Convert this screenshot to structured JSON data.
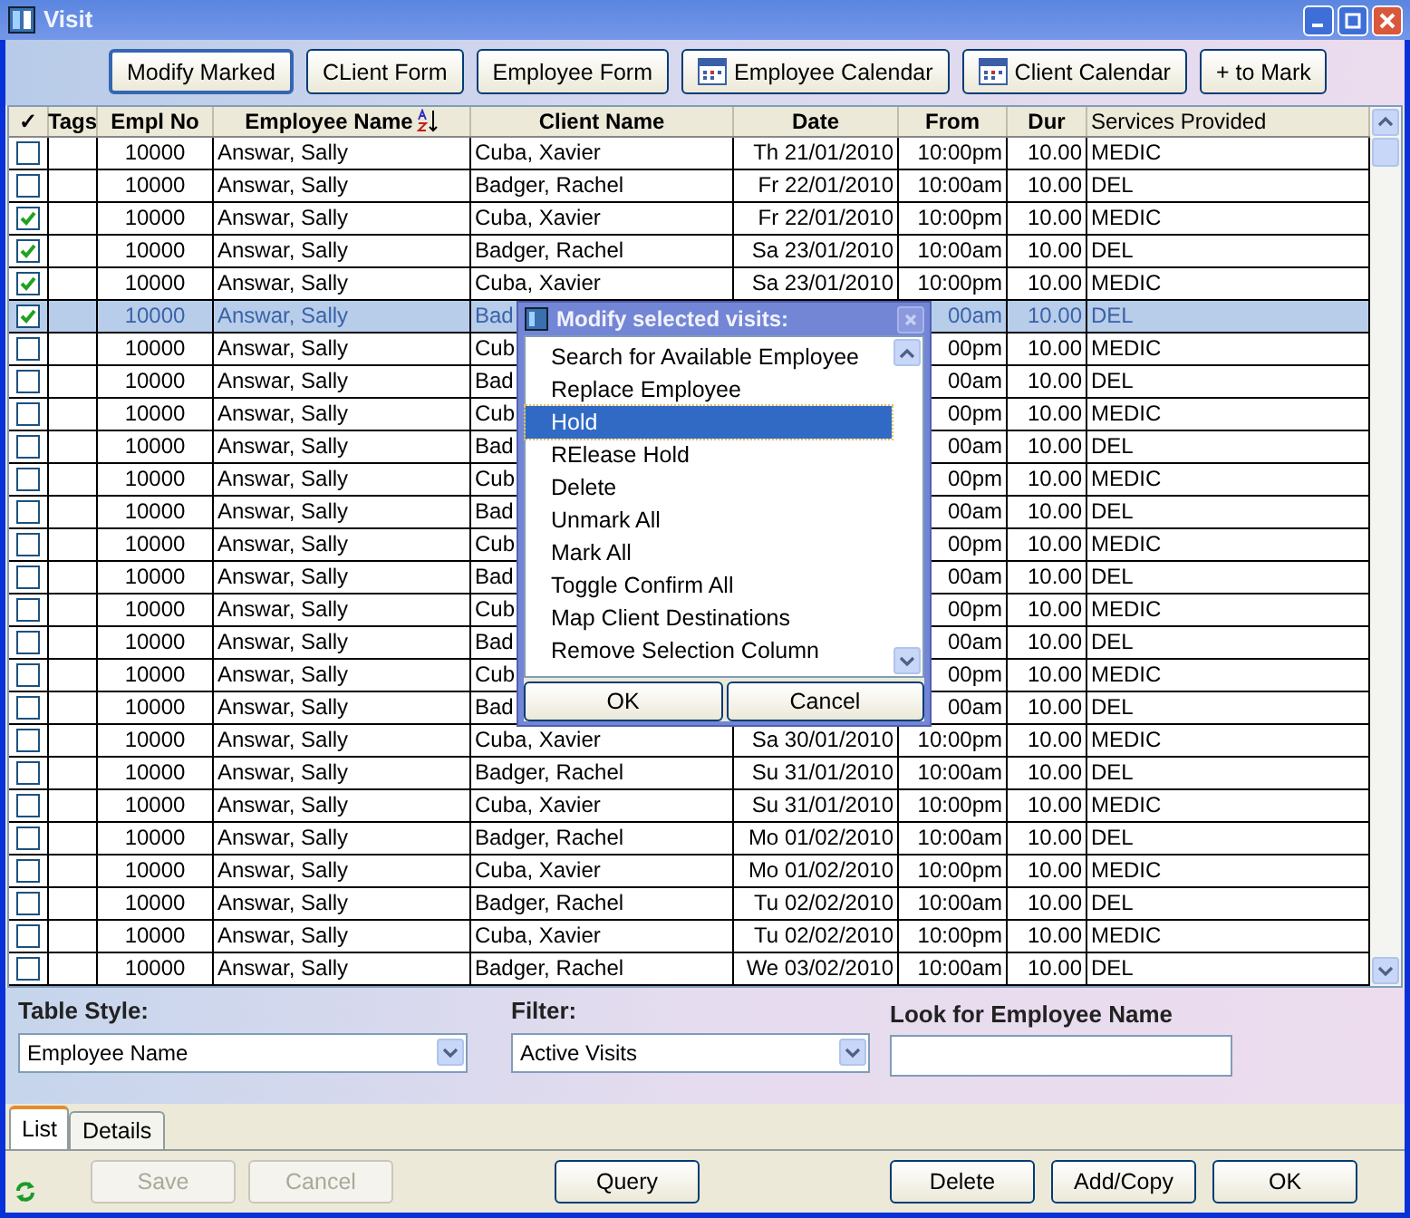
{
  "window": {
    "title": "Visit"
  },
  "toolbar": {
    "buttons": [
      {
        "label": "Modify Marked",
        "kind": "plain",
        "focused": true
      },
      {
        "label": "CLient Form",
        "kind": "plain",
        "focused": false
      },
      {
        "label": "Employee Form",
        "kind": "plain",
        "focused": false
      },
      {
        "label": "Employee Calendar",
        "kind": "calendar",
        "focused": false
      },
      {
        "label": "Client Calendar",
        "kind": "calendar",
        "focused": false
      },
      {
        "label": "+ to Mark",
        "kind": "plain",
        "focused": false
      }
    ]
  },
  "table": {
    "columns": [
      {
        "label": "✓",
        "sorted": false
      },
      {
        "label": "Tags",
        "sorted": false
      },
      {
        "label": "Empl No",
        "sorted": false
      },
      {
        "label": "Employee Name",
        "sorted": true
      },
      {
        "label": "Client Name",
        "sorted": false
      },
      {
        "label": "Date",
        "sorted": false
      },
      {
        "label": "From",
        "sorted": false
      },
      {
        "label": "Dur",
        "sorted": false
      },
      {
        "label": "Services Provided",
        "sorted": false
      }
    ],
    "rows": [
      {
        "checked": false,
        "selected": false,
        "empl_no": "10000",
        "employee": "Answar, Sally",
        "client": "Cuba, Xavier",
        "date": "Th 21/01/2010",
        "from": "10:00pm",
        "dur": "10.00",
        "services": "MEDIC"
      },
      {
        "checked": false,
        "selected": false,
        "empl_no": "10000",
        "employee": "Answar, Sally",
        "client": "Badger, Rachel",
        "date": "Fr 22/01/2010",
        "from": "10:00am",
        "dur": "10.00",
        "services": "DEL"
      },
      {
        "checked": true,
        "selected": false,
        "empl_no": "10000",
        "employee": "Answar, Sally",
        "client": "Cuba, Xavier",
        "date": "Fr 22/01/2010",
        "from": "10:00pm",
        "dur": "10.00",
        "services": "MEDIC"
      },
      {
        "checked": true,
        "selected": false,
        "empl_no": "10000",
        "employee": "Answar, Sally",
        "client": "Badger, Rachel",
        "date": "Sa 23/01/2010",
        "from": "10:00am",
        "dur": "10.00",
        "services": "DEL"
      },
      {
        "checked": true,
        "selected": false,
        "empl_no": "10000",
        "employee": "Answar, Sally",
        "client": "Cuba, Xavier",
        "date": "Sa 23/01/2010",
        "from": "10:00pm",
        "dur": "10.00",
        "services": "MEDIC"
      },
      {
        "checked": true,
        "selected": true,
        "empl_no": "10000",
        "employee": "Answar, Sally",
        "client": "Bad",
        "from": "00am",
        "dur": "10.00",
        "services": "DEL"
      },
      {
        "checked": false,
        "selected": false,
        "empl_no": "10000",
        "employee": "Answar, Sally",
        "client": "Cub",
        "from": "00pm",
        "dur": "10.00",
        "services": "MEDIC"
      },
      {
        "checked": false,
        "selected": false,
        "empl_no": "10000",
        "employee": "Answar, Sally",
        "client": "Bad",
        "from": "00am",
        "dur": "10.00",
        "services": "DEL"
      },
      {
        "checked": false,
        "selected": false,
        "empl_no": "10000",
        "employee": "Answar, Sally",
        "client": "Cub",
        "from": "00pm",
        "dur": "10.00",
        "services": "MEDIC"
      },
      {
        "checked": false,
        "selected": false,
        "empl_no": "10000",
        "employee": "Answar, Sally",
        "client": "Bad",
        "from": "00am",
        "dur": "10.00",
        "services": "DEL"
      },
      {
        "checked": false,
        "selected": false,
        "empl_no": "10000",
        "employee": "Answar, Sally",
        "client": "Cub",
        "from": "00pm",
        "dur": "10.00",
        "services": "MEDIC"
      },
      {
        "checked": false,
        "selected": false,
        "empl_no": "10000",
        "employee": "Answar, Sally",
        "client": "Bad",
        "from": "00am",
        "dur": "10.00",
        "services": "DEL"
      },
      {
        "checked": false,
        "selected": false,
        "empl_no": "10000",
        "employee": "Answar, Sally",
        "client": "Cub",
        "from": "00pm",
        "dur": "10.00",
        "services": "MEDIC"
      },
      {
        "checked": false,
        "selected": false,
        "empl_no": "10000",
        "employee": "Answar, Sally",
        "client": "Bad",
        "from": "00am",
        "dur": "10.00",
        "services": "DEL"
      },
      {
        "checked": false,
        "selected": false,
        "empl_no": "10000",
        "employee": "Answar, Sally",
        "client": "Cub",
        "from": "00pm",
        "dur": "10.00",
        "services": "MEDIC"
      },
      {
        "checked": false,
        "selected": false,
        "empl_no": "10000",
        "employee": "Answar, Sally",
        "client": "Bad",
        "from": "00am",
        "dur": "10.00",
        "services": "DEL"
      },
      {
        "checked": false,
        "selected": false,
        "empl_no": "10000",
        "employee": "Answar, Sally",
        "client": "Cub",
        "from": "00pm",
        "dur": "10.00",
        "services": "MEDIC"
      },
      {
        "checked": false,
        "selected": false,
        "empl_no": "10000",
        "employee": "Answar, Sally",
        "client": "Bad",
        "from": "00am",
        "dur": "10.00",
        "services": "DEL"
      },
      {
        "checked": false,
        "selected": false,
        "empl_no": "10000",
        "employee": "Answar, Sally",
        "client": "Cuba, Xavier",
        "date": "Sa 30/01/2010",
        "from": "10:00pm",
        "dur": "10.00",
        "services": "MEDIC"
      },
      {
        "checked": false,
        "selected": false,
        "empl_no": "10000",
        "employee": "Answar, Sally",
        "client": "Badger, Rachel",
        "date": "Su 31/01/2010",
        "from": "10:00am",
        "dur": "10.00",
        "services": "DEL"
      },
      {
        "checked": false,
        "selected": false,
        "empl_no": "10000",
        "employee": "Answar, Sally",
        "client": "Cuba, Xavier",
        "date": "Su 31/01/2010",
        "from": "10:00pm",
        "dur": "10.00",
        "services": "MEDIC"
      },
      {
        "checked": false,
        "selected": false,
        "empl_no": "10000",
        "employee": "Answar, Sally",
        "client": "Badger, Rachel",
        "date": "Mo 01/02/2010",
        "from": "10:00am",
        "dur": "10.00",
        "services": "DEL"
      },
      {
        "checked": false,
        "selected": false,
        "empl_no": "10000",
        "employee": "Answar, Sally",
        "client": "Cuba, Xavier",
        "date": "Mo 01/02/2010",
        "from": "10:00pm",
        "dur": "10.00",
        "services": "MEDIC"
      },
      {
        "checked": false,
        "selected": false,
        "empl_no": "10000",
        "employee": "Answar, Sally",
        "client": "Badger, Rachel",
        "date": "Tu 02/02/2010",
        "from": "10:00am",
        "dur": "10.00",
        "services": "DEL"
      },
      {
        "checked": false,
        "selected": false,
        "empl_no": "10000",
        "employee": "Answar, Sally",
        "client": "Cuba, Xavier",
        "date": "Tu 02/02/2010",
        "from": "10:00pm",
        "dur": "10.00",
        "services": "MEDIC"
      },
      {
        "checked": false,
        "selected": false,
        "empl_no": "10000",
        "employee": "Answar, Sally",
        "client": "Badger, Rachel",
        "date": "We 03/02/2010",
        "from": "10:00am",
        "dur": "10.00",
        "services": "DEL"
      }
    ]
  },
  "dialog": {
    "title": "Modify selected visits:",
    "items": [
      {
        "label": "Search for Available Employee",
        "selected": false
      },
      {
        "label": "Replace Employee",
        "selected": false
      },
      {
        "label": "Hold",
        "selected": true
      },
      {
        "label": "RElease Hold",
        "selected": false
      },
      {
        "label": "Delete",
        "selected": false
      },
      {
        "label": "Unmark All",
        "selected": false
      },
      {
        "label": "Mark All",
        "selected": false
      },
      {
        "label": "Toggle Confirm All",
        "selected": false
      },
      {
        "label": "Map Client Destinations",
        "selected": false
      },
      {
        "label": "Remove Selection Column",
        "selected": false
      }
    ],
    "buttons": [
      "OK",
      "Cancel"
    ]
  },
  "filters": {
    "table_style": {
      "label": "Table Style:",
      "value": "Employee Name"
    },
    "filter": {
      "label": "Filter:",
      "value": "Active Visits"
    },
    "search": {
      "label": "Look for Employee Name"
    }
  },
  "tabs": [
    {
      "label": "List",
      "selected": true
    },
    {
      "label": "Details",
      "selected": false
    }
  ],
  "buttons": [
    {
      "label": "Save",
      "disabled": true
    },
    {
      "label": "Cancel",
      "disabled": true
    },
    {
      "label": "Query",
      "disabled": false
    },
    {
      "label": "Delete",
      "disabled": false
    },
    {
      "label": "Add/Copy",
      "disabled": false
    },
    {
      "label": "OK",
      "disabled": false
    }
  ]
}
